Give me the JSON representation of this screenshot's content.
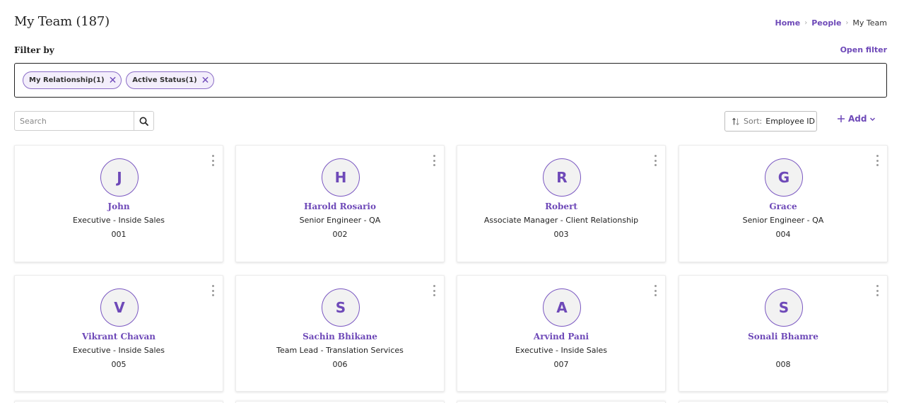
{
  "header": {
    "title": "My Team (187)",
    "breadcrumb": [
      {
        "label": "Home"
      },
      {
        "label": "People"
      },
      {
        "label": "My Team"
      }
    ]
  },
  "filter": {
    "label": "Filter by",
    "open_filter": "Open filter",
    "chips": [
      {
        "label": "My Relationship(1)"
      },
      {
        "label": "Active Status(1)"
      }
    ]
  },
  "toolbar": {
    "search_placeholder": "Search",
    "sort_label": "Sort:",
    "sort_value": "Employee ID",
    "add_label": "Add"
  },
  "colors": {
    "accent": "#6e49b8"
  },
  "employees": [
    {
      "initial": "J",
      "name": "John",
      "role": "Executive - Inside Sales",
      "id": "001"
    },
    {
      "initial": "H",
      "name": "Harold Rosario",
      "role": "Senior Engineer - QA",
      "id": "002"
    },
    {
      "initial": "R",
      "name": "Robert",
      "role": "Associate Manager - Client Relationship",
      "id": "003"
    },
    {
      "initial": "G",
      "name": "Grace",
      "role": "Senior Engineer - QA",
      "id": "004"
    },
    {
      "initial": "V",
      "name": "Vikrant Chavan",
      "role": "Executive - Inside Sales",
      "id": "005"
    },
    {
      "initial": "S",
      "name": "Sachin Bhikane",
      "role": "Team Lead - Translation Services",
      "id": "006"
    },
    {
      "initial": "A",
      "name": "Arvind Pani",
      "role": "Executive - Inside Sales",
      "id": "007"
    },
    {
      "initial": "S",
      "name": "Sonali Bhamre",
      "role": "",
      "id": "008"
    }
  ]
}
